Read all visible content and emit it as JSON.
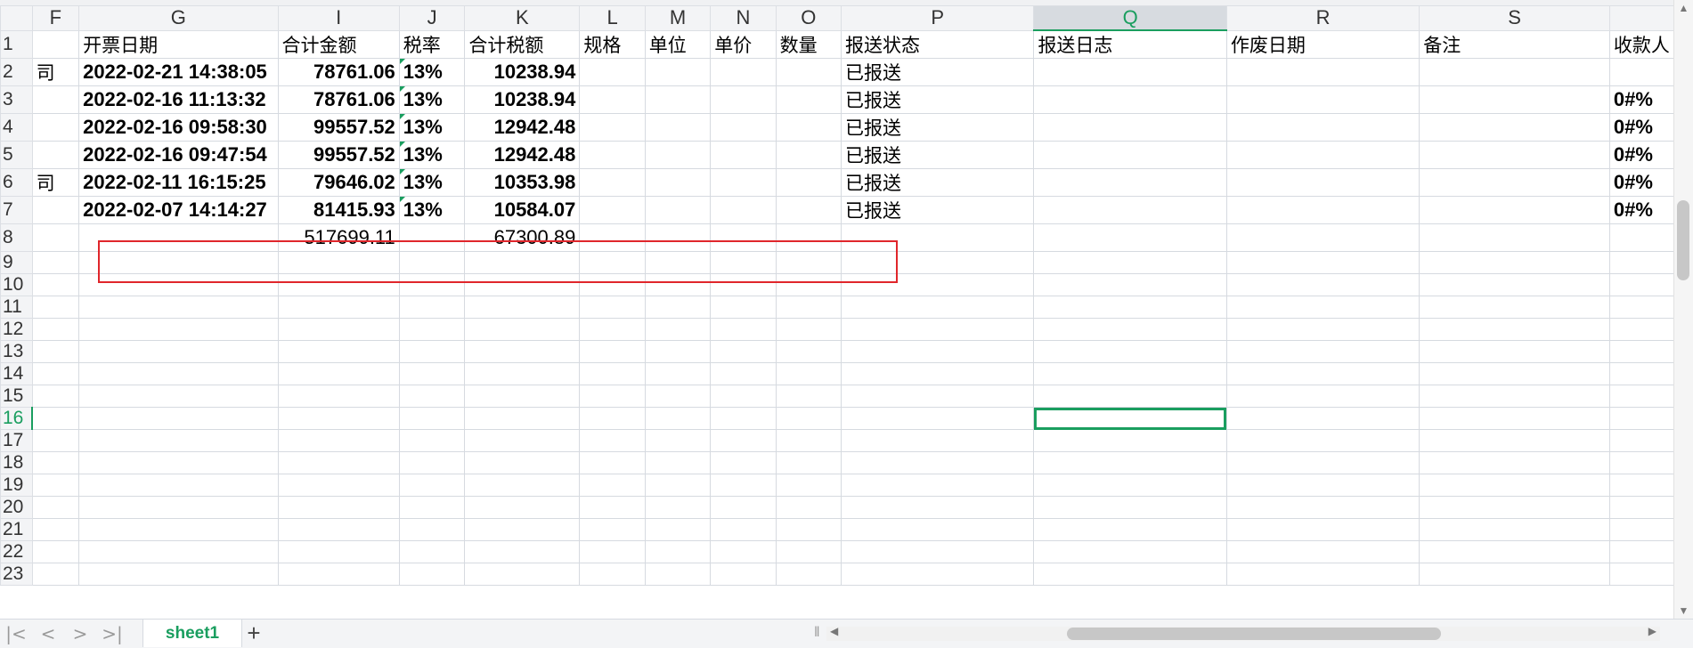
{
  "columns": [
    "F",
    "G",
    "I",
    "J",
    "K",
    "L",
    "M",
    "N",
    "O",
    "P",
    "Q",
    "R",
    "S",
    ""
  ],
  "selected_column": "Q",
  "header_row": {
    "row": "1",
    "F": "",
    "G": "开票日期",
    "I": "合计金额",
    "J": "税率",
    "K": "合计税额",
    "L": "规格",
    "M": "单位",
    "N": "单价",
    "O": "数量",
    "P": "报送状态",
    "Q": "报送日志",
    "R": "作废日期",
    "S": "备注",
    "T": "收款人"
  },
  "rows": [
    {
      "row": "2",
      "F": "司",
      "G": "2022-02-21 14:38:05",
      "I": "78761.06",
      "J": "13%",
      "K": "10238.94",
      "P": "已报送",
      "T": ""
    },
    {
      "row": "3",
      "F": "",
      "G": "2022-02-16 11:13:32",
      "I": "78761.06",
      "J": "13%",
      "K": "10238.94",
      "P": "已报送",
      "T": "0#%"
    },
    {
      "row": "4",
      "F": "",
      "G": "2022-02-16 09:58:30",
      "I": "99557.52",
      "J": "13%",
      "K": "12942.48",
      "P": "已报送",
      "T": "0#%"
    },
    {
      "row": "5",
      "F": "",
      "G": "2022-02-16 09:47:54",
      "I": "99557.52",
      "J": "13%",
      "K": "12942.48",
      "P": "已报送",
      "T": "0#%"
    },
    {
      "row": "6",
      "F": "司",
      "G": "2022-02-11 16:15:25",
      "I": "79646.02",
      "J": "13%",
      "K": "10353.98",
      "P": "已报送",
      "T": "0#%"
    },
    {
      "row": "7",
      "F": "",
      "G": "2022-02-07 14:14:27",
      "I": "81415.93",
      "J": "13%",
      "K": "10584.07",
      "P": "已报送",
      "T": "0#%"
    }
  ],
  "totals": {
    "row": "8",
    "I": "517699.11",
    "K": "67300.89"
  },
  "empty_rows": [
    "9",
    "10",
    "11",
    "12",
    "13",
    "14",
    "15",
    "16",
    "17",
    "18",
    "19",
    "20",
    "21",
    "22",
    "23"
  ],
  "selected_row": "16",
  "sheet_tab": "sheet1",
  "add_sheet": "+",
  "nav": {
    "first": "|<",
    "prev": "<",
    "next": ">",
    "last": ">|"
  },
  "colors": {
    "accent": "#1a9e5f",
    "annotation": "#e0262b",
    "gridline": "#d6dae0"
  }
}
